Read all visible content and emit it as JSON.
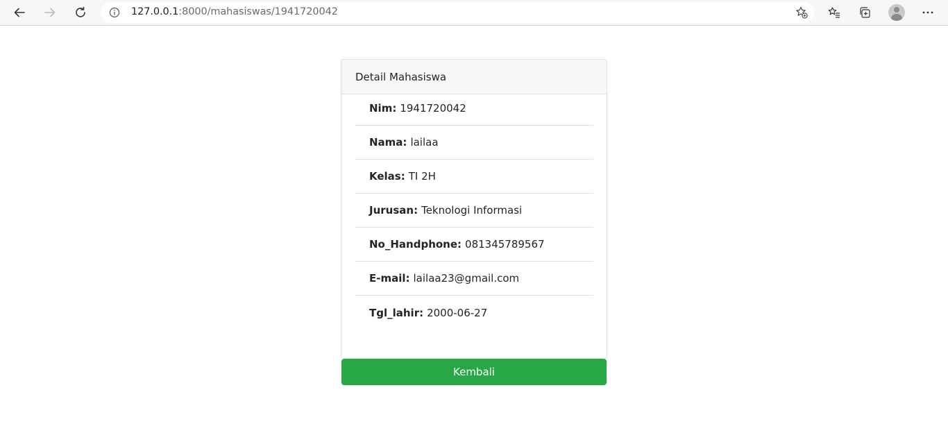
{
  "browser": {
    "url_host": "127.0.0.1",
    "url_rest": ":8000/mahasiswas/1941720042"
  },
  "card": {
    "title": "Detail Mahasiswa",
    "fields": [
      {
        "label": "Nim:",
        "value": "1941720042"
      },
      {
        "label": "Nama:",
        "value": "lailaa"
      },
      {
        "label": "Kelas:",
        "value": "TI 2H"
      },
      {
        "label": "Jurusan:",
        "value": "Teknologi Informasi"
      },
      {
        "label": "No_Handphone:",
        "value": "081345789567"
      },
      {
        "label": "E-mail:",
        "value": "lailaa23@gmail.com"
      },
      {
        "label": "Tgl_lahir:",
        "value": "2000-06-27"
      }
    ]
  },
  "button": {
    "back_label": "Kembali",
    "color": "#28a745"
  },
  "icons": [
    "back-arrow-icon",
    "forward-arrow-icon",
    "refresh-icon",
    "info-icon",
    "add-favorite-icon",
    "favorites-icon",
    "collections-icon",
    "profile-avatar-icon",
    "more-icon"
  ]
}
